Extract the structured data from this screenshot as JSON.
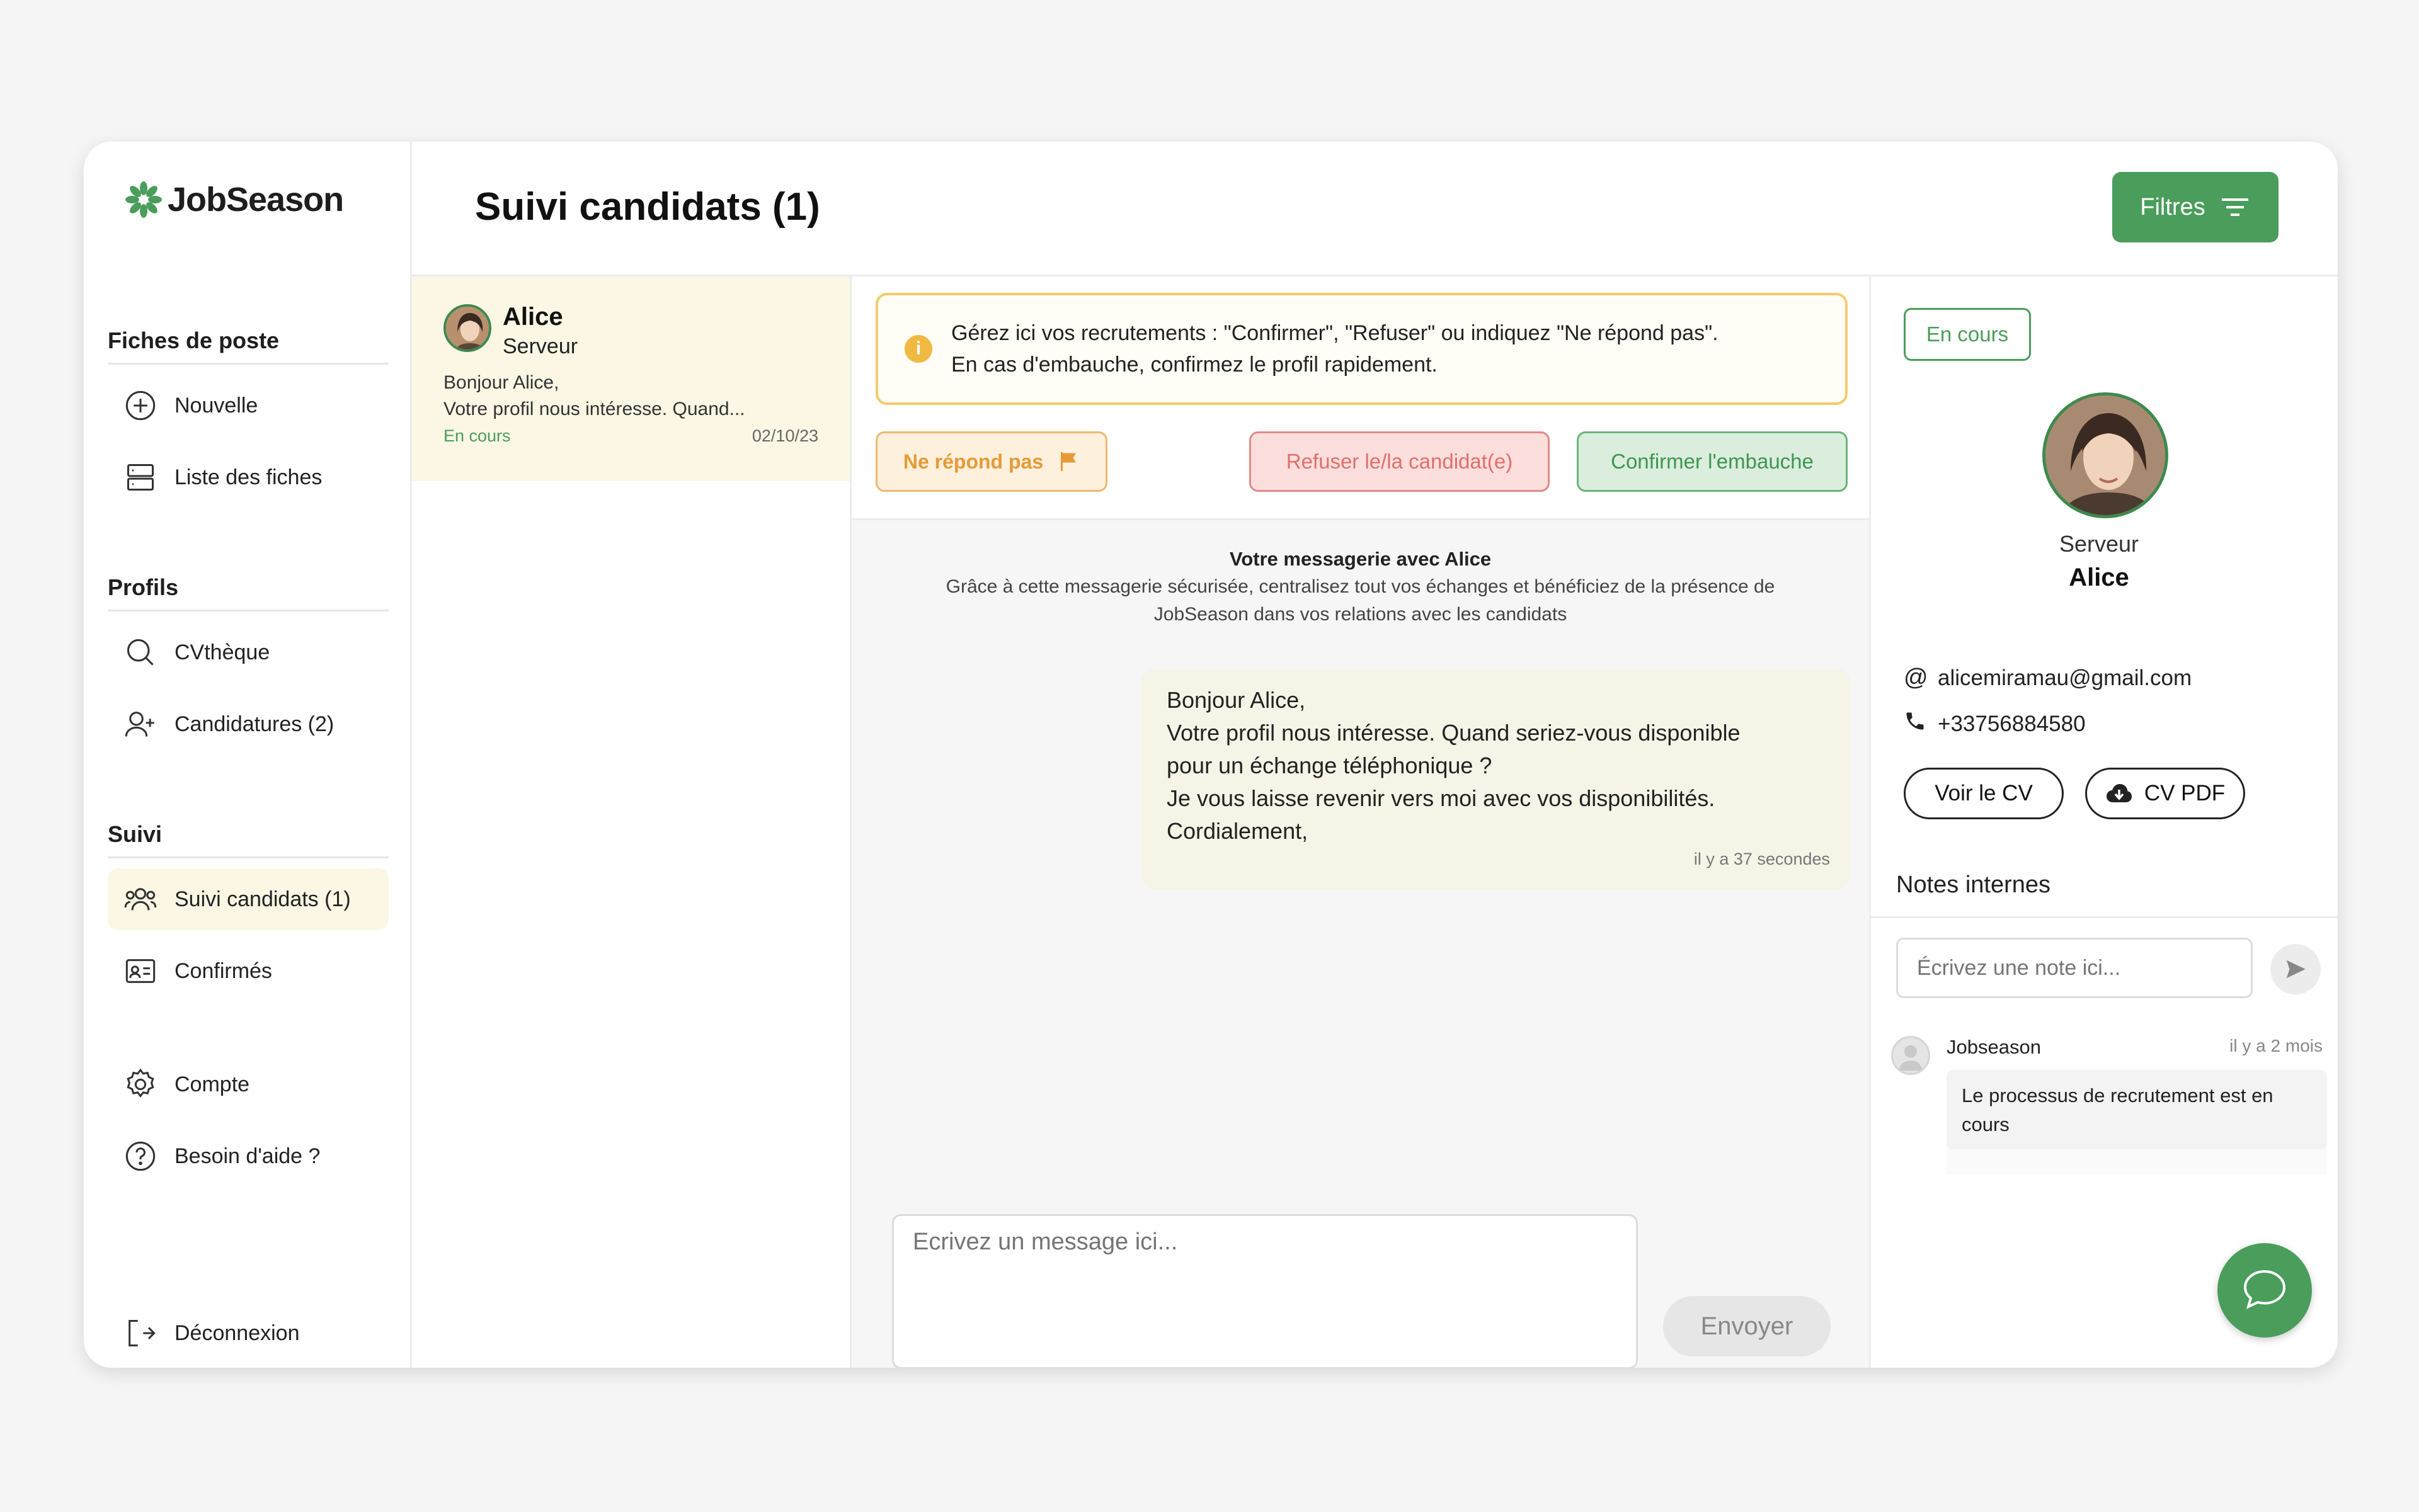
{
  "app": {
    "logo_text": "JobSeason"
  },
  "sidebar": {
    "sections": [
      {
        "title": "Fiches de poste",
        "items": [
          "Nouvelle",
          "Liste des fiches"
        ]
      },
      {
        "title": "Profils",
        "items": [
          "CVthèque",
          "Candidatures (2)"
        ]
      },
      {
        "title": "Suivi",
        "items": [
          "Suivi candidats (1)",
          "Confirmés"
        ]
      }
    ],
    "bottom_items": [
      "Compte",
      "Besoin d'aide ?"
    ],
    "logout": "Déconnexion"
  },
  "header": {
    "title": "Suivi candidats (1)",
    "filters_label": "Filtres"
  },
  "candidate_list": [
    {
      "name": "Alice",
      "role": "Serveur",
      "preview_line1": "Bonjour Alice,",
      "preview_line2": "Votre profil nous intéresse. Quand...",
      "status": "En cours",
      "date": "02/10/23"
    }
  ],
  "info_box": {
    "line1": "Gérez ici vos recrutements : \"Confirmer\", \"Refuser\" ou indiquez \"Ne répond pas\".",
    "line2": "En cas d'embauche, confirmez le profil rapidement."
  },
  "actions": {
    "no_reply": "Ne répond pas",
    "refuse": "Refuser le/la candidat(e)",
    "confirm": "Confirmer l'embauche"
  },
  "chat": {
    "title": "Votre messagerie avec Alice",
    "subtitle_line1": "Grâce à cette messagerie sécurisée, centralisez tout vos échanges et bénéficiez de la présence de",
    "subtitle_line2": "JobSeason dans vos relations avec les candidats",
    "message_lines": [
      "Bonjour Alice,",
      "Votre profil nous intéresse. Quand seriez-vous disponible",
      "pour un échange téléphonique ?",
      "Je vous laisse revenir vers moi avec vos disponibilités.",
      "Cordialement,"
    ],
    "message_time": "il y a 37 secondes",
    "input_placeholder": "Ecrivez un message ici...",
    "send_label": "Envoyer"
  },
  "profile": {
    "status": "En cours",
    "role": "Serveur",
    "name": "Alice",
    "email": "alicemiramau@gmail.com",
    "phone": "+33756884580",
    "view_cv": "Voir le CV",
    "cv_pdf": "CV PDF"
  },
  "notes": {
    "title": "Notes internes",
    "input_placeholder": "Écrivez une note ici...",
    "items": [
      {
        "author": "Jobseason",
        "time": "il y a 2 mois",
        "text": "Le processus de recrutement est en cours"
      }
    ]
  },
  "colors": {
    "brand_green": "#4a9d5b",
    "accent_yellow": "#f1cd6b",
    "refuse_red": "#e0706a",
    "noreply_orange": "#e69a38"
  }
}
